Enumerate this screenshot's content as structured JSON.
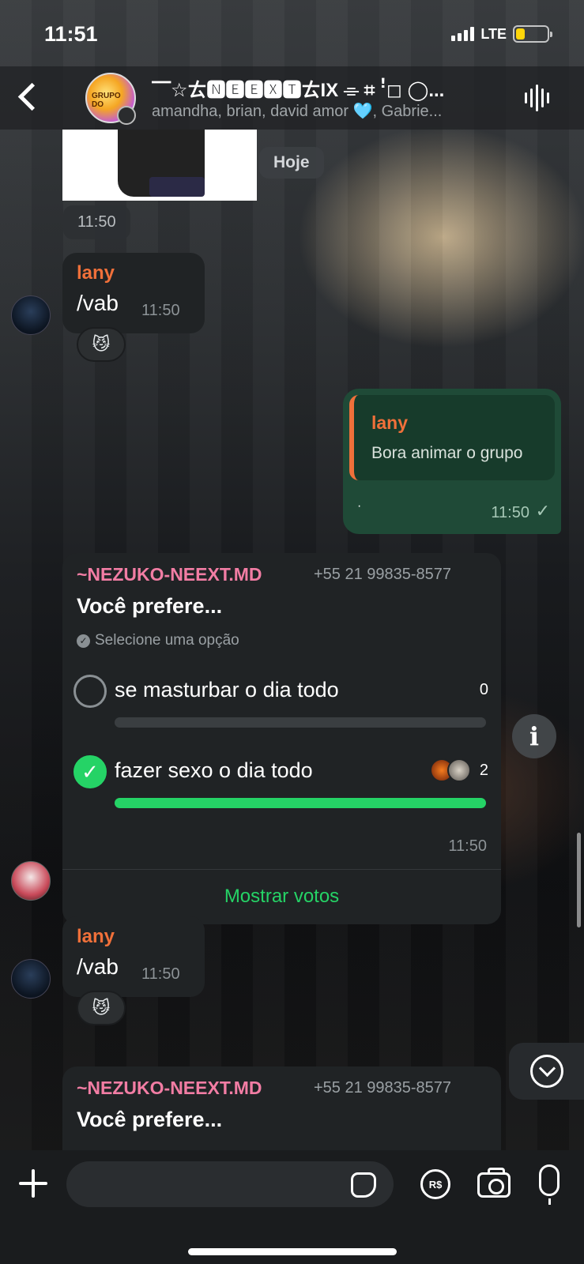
{
  "status_bar": {
    "time": "11:51",
    "network": "LTE",
    "battery_color": "#ffd60a",
    "battery_level": 0.3
  },
  "header": {
    "avatar_label": "GRUPO DO",
    "title": "⎺☆ㄊ🅽🅴🅴🆇🆃ㄊIX ⌯ ⌗ ꜝ◻ ◯...",
    "members": "amandha, brian, david amor 🩵, Gabrie..."
  },
  "chat": {
    "day_chip": "Hoje",
    "sticker_time": "11:50",
    "messages": [
      {
        "sender": "lany",
        "text": "/vab",
        "time": "11:50",
        "reaction": "😼"
      },
      {
        "quoted_sender": "lany",
        "quoted_text": "Bora animar o grupo",
        "text": "·",
        "time": "11:50",
        "status": "✓"
      },
      {
        "sender": "~NEZUKO-NEEXT.MD",
        "phone": "+55 21 99835-8577",
        "question": "Você prefere...",
        "hint": "Selecione uma opção",
        "options": [
          {
            "label": "se masturbar o dia todo",
            "count": "0",
            "fraction": 0
          },
          {
            "label": "fazer sexo o dia todo",
            "count": "2",
            "fraction": 1
          }
        ],
        "time": "11:50",
        "view_votes": "Mostrar votos"
      },
      {
        "sender": "lany",
        "text": "/vab",
        "time": "11:50",
        "reaction": "😼"
      },
      {
        "sender": "~NEZUKO-NEEXT.MD",
        "phone": "+55 21 99835-8577",
        "question": "Você prefere..."
      }
    ]
  },
  "composer": {
    "placeholder": "",
    "pay_label": "R$"
  },
  "colors": {
    "accent_green": "#25d366",
    "sender_orange": "#f0703a",
    "bot_pink": "#f27da4",
    "outgoing_bubble": "#1f4a37"
  }
}
